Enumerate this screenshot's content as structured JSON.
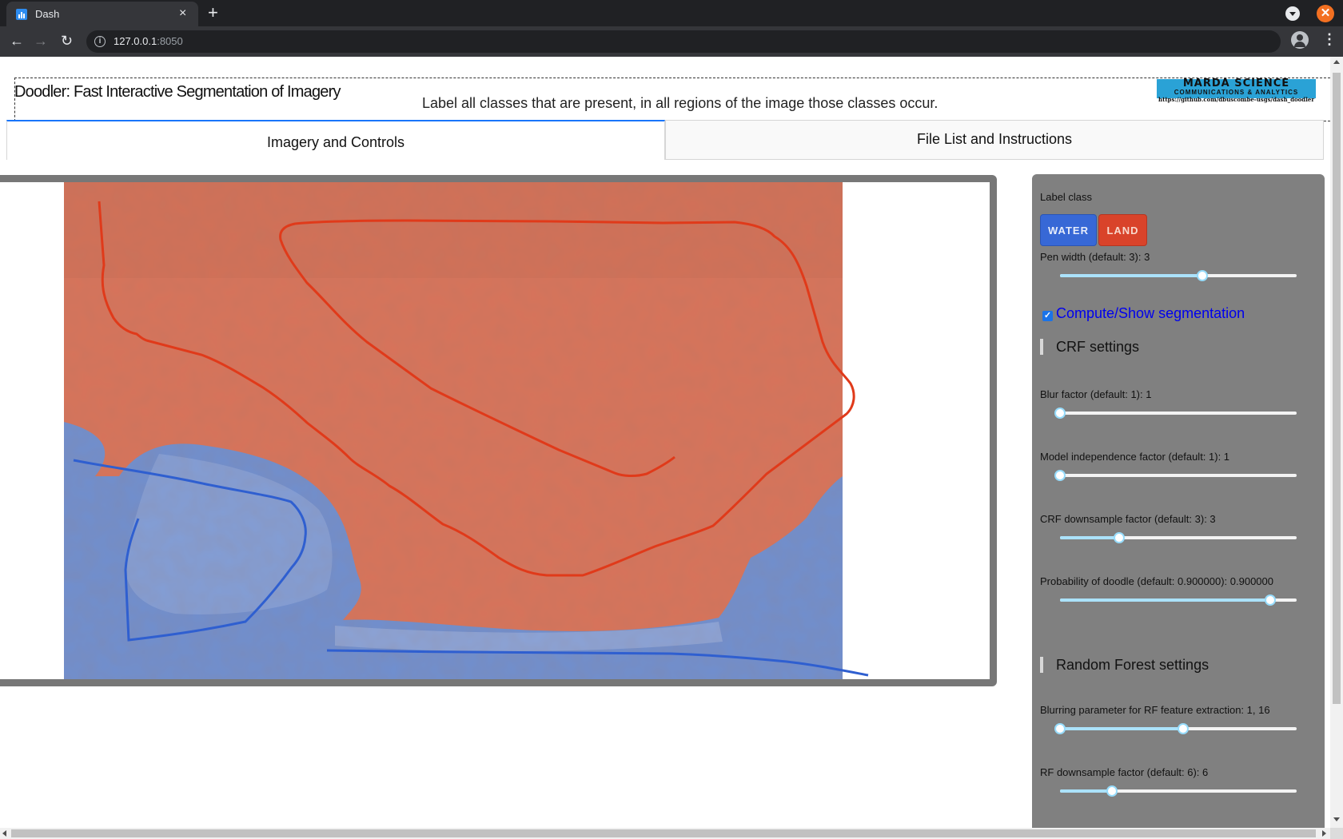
{
  "browser": {
    "tab_title": "Dash",
    "tab_close": "×",
    "new_tab": "+",
    "url_host": "127.0.0.1",
    "url_port": ":8050",
    "info_glyph": "i",
    "star_glyph": "★",
    "menu_glyph": "⋮",
    "close_glyph": "✕",
    "back_glyph": "←",
    "forward_glyph": "→",
    "reload_glyph": "↻"
  },
  "header": {
    "title": "Doodler: Fast Interactive Segmentation of Imagery",
    "instructions": "Label all classes that are present, in all regions of the image those classes occur.",
    "logo_line1": "MARDA SCIENCE",
    "logo_line2": "COMMUNICATIONS & ANALYTICS",
    "logo_url": "https://github.com/dbuscombe-usgs/dash_doodler"
  },
  "tabs": [
    {
      "label": "Imagery and Controls",
      "active": true
    },
    {
      "label": "File List and Instructions",
      "active": false
    }
  ],
  "sidebar": {
    "label_class": "Label class",
    "class_buttons": [
      {
        "label": "WATER",
        "color": "#3768d6"
      },
      {
        "label": "LAND",
        "color": "#d9432a"
      }
    ],
    "pen_width": {
      "label": "Pen width (default: 3): 3",
      "value": 3,
      "fraction": 0.6
    },
    "compute_checkbox": {
      "label": "Compute/Show segmentation",
      "checked": true,
      "check_glyph": "✓"
    },
    "crf_heading": "CRF settings",
    "blur_factor": {
      "label": "Blur factor (default: 1): 1",
      "value": 1,
      "fraction": 0.0
    },
    "model_independence": {
      "label": "Model independence factor (default: 1): 1",
      "value": 1,
      "fraction": 0.0
    },
    "crf_downsample": {
      "label": "CRF downsample factor (default: 3): 3",
      "value": 3,
      "fraction": 0.25
    },
    "probability_doodle": {
      "label": "Probability of doodle (default: 0.900000): 0.900000",
      "value": 0.9,
      "fraction": 0.89
    },
    "rf_heading": "Random Forest settings",
    "rf_blurring": {
      "label": "Blurring parameter for RF feature extraction: 1, 16",
      "values": [
        1,
        16
      ],
      "fraction_low": 0.0,
      "fraction_high": 0.52
    },
    "rf_downsample": {
      "label": "RF downsample factor (default: 6): 6",
      "value": 6,
      "fraction": 0.22
    }
  },
  "colors": {
    "water_overlay": "#6f8fd0",
    "land_overlay": "#d8735a",
    "water_stroke": "#2f5fd0",
    "land_stroke": "#e03a1a",
    "accent": "#1975fa"
  }
}
